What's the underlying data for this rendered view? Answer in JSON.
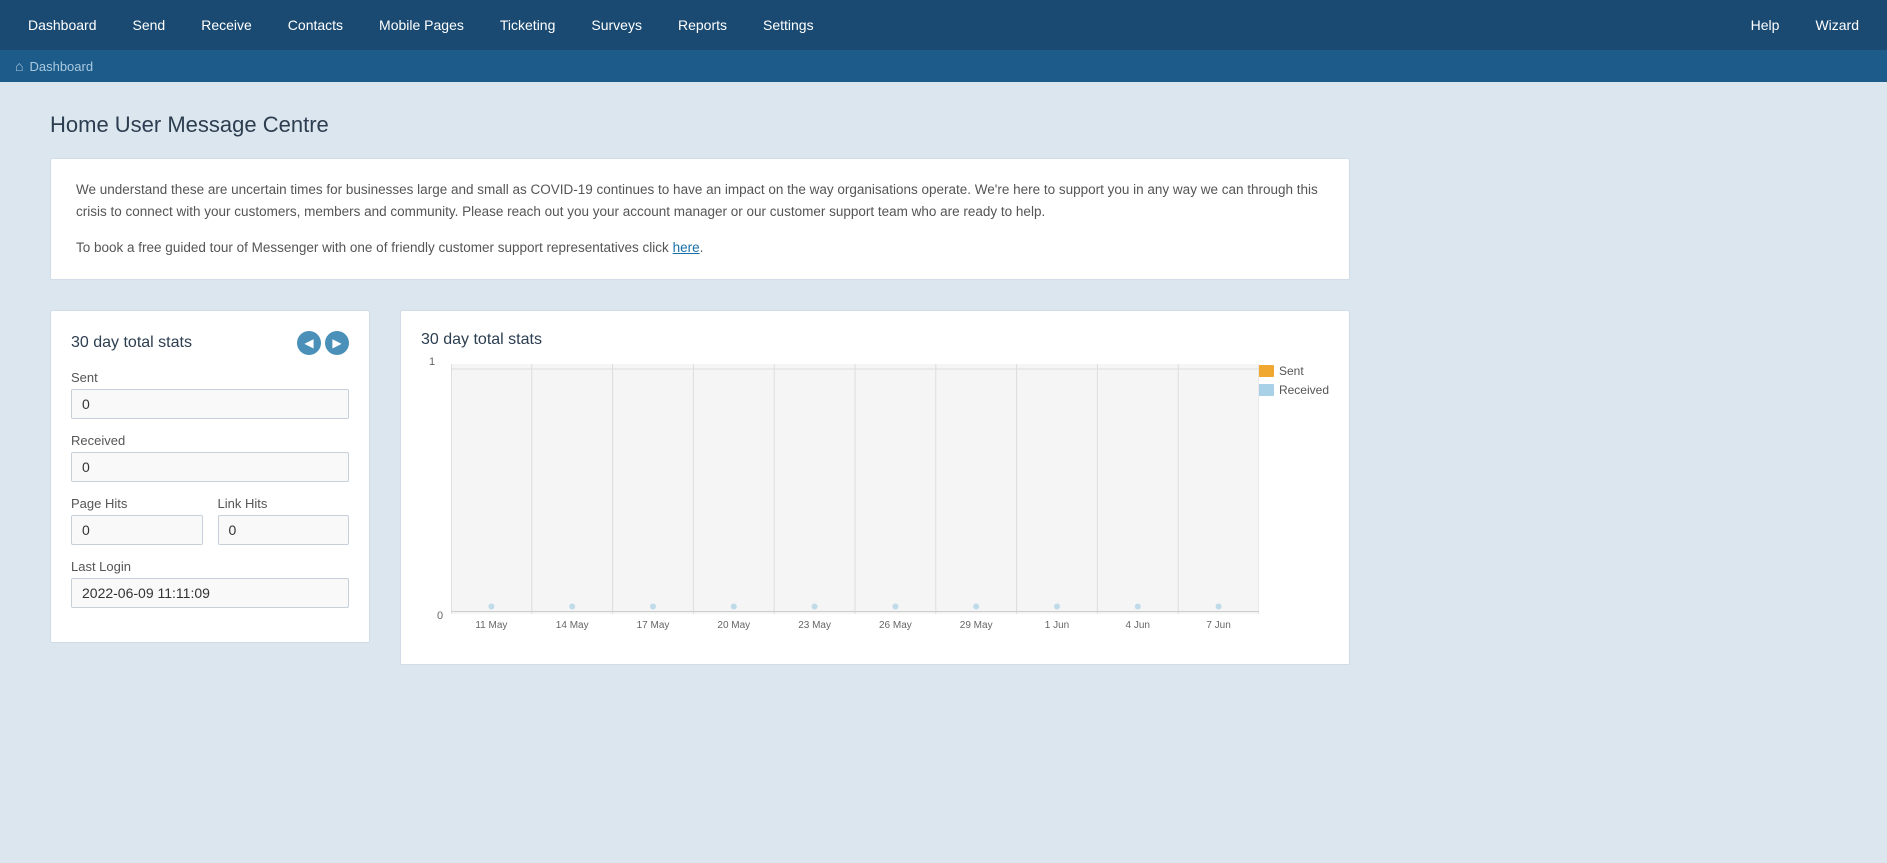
{
  "nav": {
    "items": [
      {
        "label": "Dashboard",
        "active": true
      },
      {
        "label": "Send",
        "active": false
      },
      {
        "label": "Receive",
        "active": false
      },
      {
        "label": "Contacts",
        "active": false
      },
      {
        "label": "Mobile Pages",
        "active": false
      },
      {
        "label": "Ticketing",
        "active": false
      },
      {
        "label": "Surveys",
        "active": false
      },
      {
        "label": "Reports",
        "active": false
      },
      {
        "label": "Settings",
        "active": false
      }
    ],
    "right_items": [
      {
        "label": "Help"
      },
      {
        "label": "Wizard"
      }
    ]
  },
  "breadcrumb": {
    "label": "Dashboard"
  },
  "page": {
    "title": "Home User Message Centre",
    "message1": "We understand these are uncertain times for businesses large and small as COVID-19 continues to have an impact on the way organisations operate. We're here to support you in any way we can through this crisis to connect with your customers, members and community. Please reach out you your account manager or our customer support team who are ready to help.",
    "message2_prefix": "To book a free guided tour of Messenger with one of friendly customer support representatives click ",
    "message2_link": "here",
    "message2_suffix": "."
  },
  "stats_left": {
    "title": "30 day total stats",
    "sent_label": "Sent",
    "sent_value": "0",
    "received_label": "Received",
    "received_value": "0",
    "page_hits_label": "Page Hits",
    "page_hits_value": "0",
    "link_hits_label": "Link Hits",
    "link_hits_value": "0",
    "last_login_label": "Last Login",
    "last_login_value": "2022-06-09 11:11:09"
  },
  "stats_chart": {
    "title": "30 day total stats",
    "y_max": "1",
    "y_min": "0",
    "legend": [
      {
        "label": "Sent",
        "color": "#f0a830"
      },
      {
        "label": "Received",
        "color": "#a8d0e6"
      }
    ],
    "x_labels": [
      "11 May",
      "14 May",
      "17 May",
      "20 May",
      "23 May",
      "26 May",
      "29 May",
      "1 Jun",
      "4 Jun",
      "7 Jun"
    ]
  },
  "icons": {
    "home": "⌂",
    "prev": "◀",
    "next": "▶"
  }
}
